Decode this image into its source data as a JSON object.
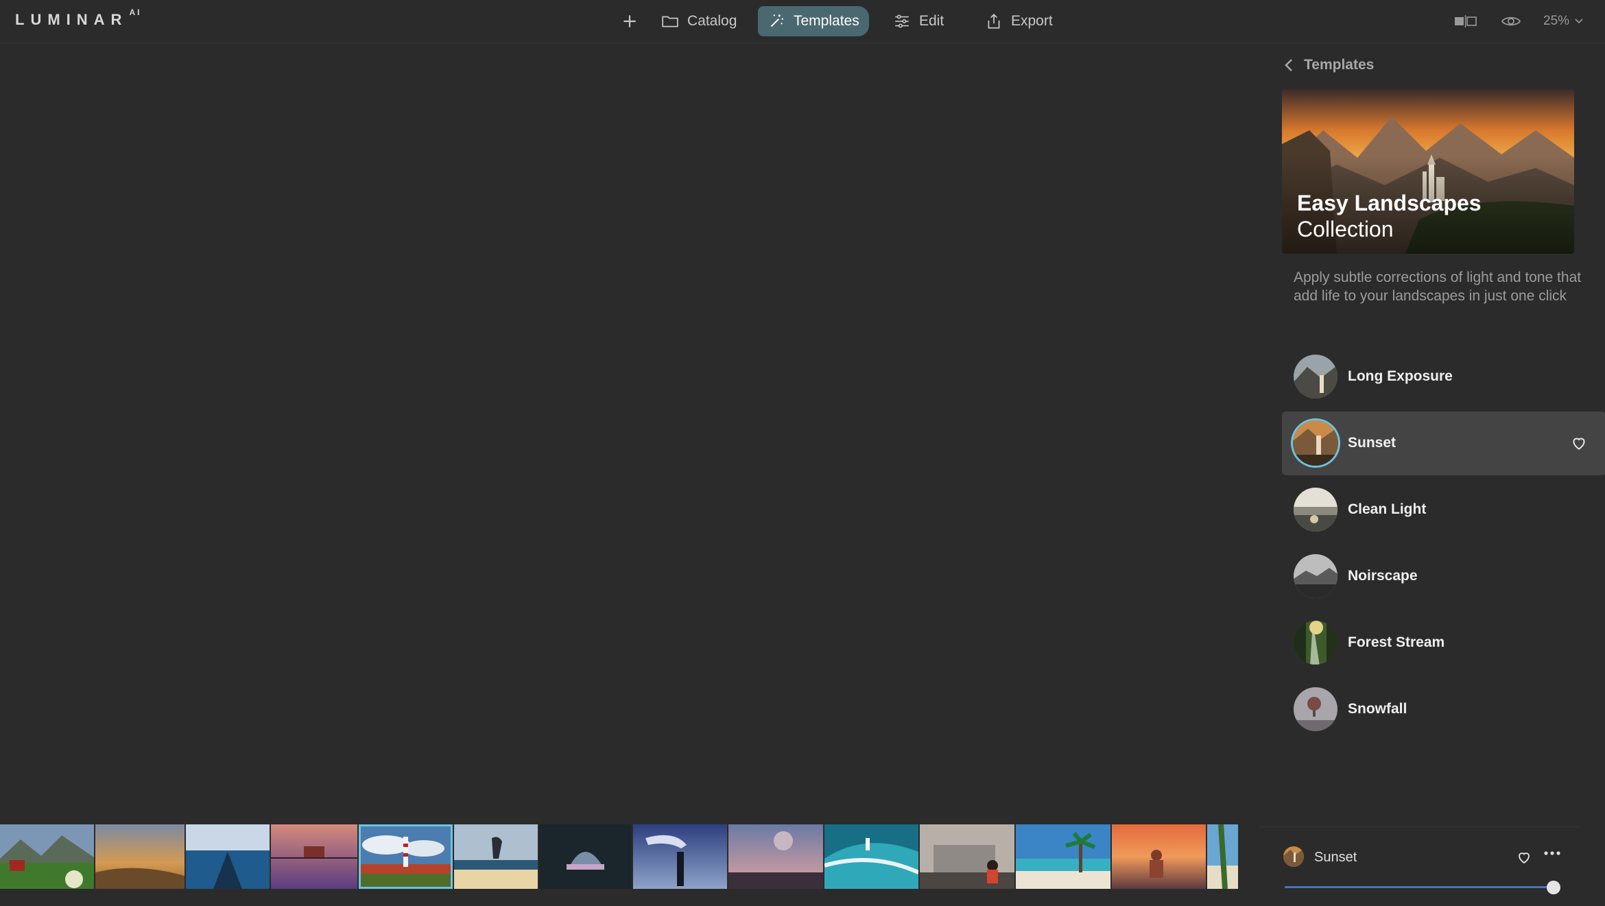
{
  "app": {
    "logo": "LUMINAR",
    "logo_super": "AI"
  },
  "nav": {
    "catalog": "Catalog",
    "templates": "Templates",
    "edit": "Edit",
    "export": "Export",
    "active": "templates"
  },
  "view": {
    "zoom": "25%"
  },
  "panel": {
    "back_label": "Templates",
    "collection_title": "Easy Landscapes",
    "collection_subtitle": "Collection",
    "description": "Apply subtle corrections of light and tone that add life to your landscapes in just one click",
    "templates": [
      {
        "name": "Long Exposure",
        "active": false
      },
      {
        "name": "Sunset",
        "active": true
      },
      {
        "name": "Clean Light",
        "active": false
      },
      {
        "name": "Noirscape",
        "active": false
      },
      {
        "name": "Forest Stream",
        "active": false
      },
      {
        "name": "Snowfall",
        "active": false
      }
    ]
  },
  "strength": {
    "template_name": "Sunset",
    "amount_percent": 100
  },
  "filmstrip": {
    "count": 14,
    "selected_index": 4
  },
  "colors": {
    "accent": "#6cc4e0",
    "nav_active": "#4a6870",
    "slider": "#3b78c7"
  }
}
